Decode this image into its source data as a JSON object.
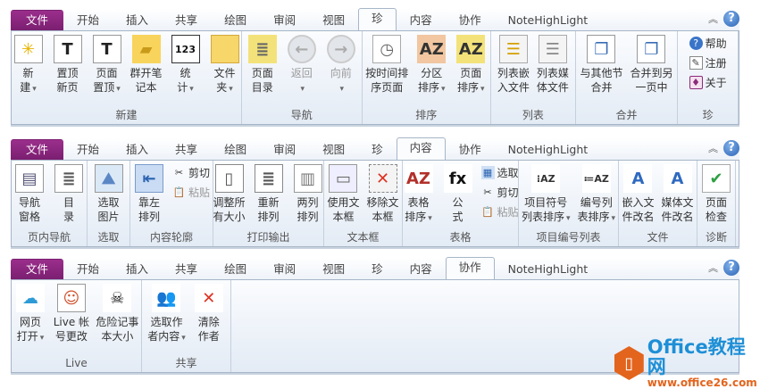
{
  "ribbons": [
    {
      "tabs": [
        "文件",
        "开始",
        "插入",
        "共享",
        "绘图",
        "审阅",
        "视图",
        "珍",
        "内容",
        "协作",
        "NoteHighLight"
      ],
      "active": 7,
      "groups": [
        {
          "label": "新建",
          "items": [
            {
              "type": "large",
              "l1": "新",
              "l2": "建",
              "dd": true,
              "icon": "new-page"
            },
            {
              "type": "large",
              "l1": "置顶",
              "l2": "新页",
              "icon": "new-top-page"
            },
            {
              "type": "large",
              "l1": "页面",
              "l2": "置顶",
              "dd": true,
              "icon": "page-top"
            },
            {
              "type": "large",
              "l1": "群开笔",
              "l2": "记本",
              "icon": "open-folder"
            },
            {
              "type": "large",
              "l1": "统",
              "l2": "计",
              "dd": true,
              "icon": "abc-123"
            },
            {
              "type": "large",
              "l1": "文件",
              "l2": "夹",
              "dd": true,
              "icon": "folder"
            }
          ]
        },
        {
          "label": "导航",
          "items": [
            {
              "type": "large",
              "l1": "页面",
              "l2": "目录",
              "icon": "page-toc"
            },
            {
              "type": "large",
              "l1": "返回",
              "l2": "",
              "dd": true,
              "icon": "back-arrow",
              "disabled": true
            },
            {
              "type": "large",
              "l1": "向前",
              "l2": "",
              "dd": true,
              "icon": "forward-arrow",
              "disabled": true
            }
          ]
        },
        {
          "label": "排序",
          "items": [
            {
              "type": "large",
              "l1": "按时间排",
              "l2": "序页面",
              "icon": "clock-sort"
            },
            {
              "type": "large",
              "l1": "分区",
              "l2": "排序",
              "dd": true,
              "icon": "section-sort"
            },
            {
              "type": "large",
              "l1": "页面",
              "l2": "排序",
              "dd": true,
              "icon": "page-sort"
            }
          ]
        },
        {
          "label": "列表",
          "items": [
            {
              "type": "large",
              "l1": "列表嵌",
              "l2": "入文件",
              "icon": "list-embed"
            },
            {
              "type": "large",
              "l1": "列表媒",
              "l2": "体文件",
              "icon": "list-media"
            }
          ]
        },
        {
          "label": "合并",
          "items": [
            {
              "type": "large",
              "l1": "与其他节",
              "l2": "合并",
              "icon": "merge-section"
            },
            {
              "type": "large",
              "l1": "合并到另",
              "l2": "一页中",
              "icon": "merge-page"
            }
          ]
        },
        {
          "label": "珍",
          "items": [
            {
              "type": "stack",
              "items": [
                {
                  "label": "帮助",
                  "icon": "help"
                },
                {
                  "label": "注册",
                  "icon": "register"
                },
                {
                  "label": "关于",
                  "icon": "about"
                }
              ]
            }
          ]
        }
      ]
    },
    {
      "tabs": [
        "文件",
        "开始",
        "插入",
        "共享",
        "绘图",
        "审阅",
        "视图",
        "珍",
        "内容",
        "协作",
        "NoteHighLight"
      ],
      "active": 8,
      "groups": [
        {
          "label": "页内导航",
          "items": [
            {
              "type": "large",
              "l1": "导航",
              "l2": "窗格",
              "icon": "nav-pane"
            },
            {
              "type": "large",
              "l1": "目",
              "l2": "录",
              "icon": "toc"
            }
          ]
        },
        {
          "label": "选取",
          "items": [
            {
              "type": "large",
              "l1": "选取",
              "l2": "图片",
              "icon": "select-picture"
            }
          ]
        },
        {
          "label": "内容轮廓",
          "items": [
            {
              "type": "large",
              "l1": "靠左",
              "l2": "排列",
              "icon": "align-left"
            },
            {
              "type": "stack",
              "items": [
                {
                  "label": "剪切",
                  "icon": "cut"
                },
                {
                  "label": "粘贴",
                  "icon": "paste",
                  "disabled": true
                }
              ]
            }
          ]
        },
        {
          "label": "打印输出",
          "items": [
            {
              "type": "large",
              "l1": "调整所",
              "l2": "有大小",
              "icon": "resize"
            },
            {
              "type": "large",
              "l1": "重新",
              "l2": "排列",
              "icon": "rearrange"
            },
            {
              "type": "large",
              "l1": "两列",
              "l2": "排列",
              "icon": "two-columns"
            }
          ]
        },
        {
          "label": "文本框",
          "items": [
            {
              "type": "large",
              "l1": "使用文",
              "l2": "本框",
              "icon": "textbox"
            },
            {
              "type": "large",
              "l1": "移除文",
              "l2": "本框",
              "icon": "remove-textbox"
            }
          ]
        },
        {
          "label": "表格",
          "items": [
            {
              "type": "large",
              "l1": "表格",
              "l2": "排序",
              "dd": true,
              "icon": "table-sort"
            },
            {
              "type": "large",
              "l1": "公",
              "l2": "式",
              "icon": "formula"
            },
            {
              "type": "stack",
              "items": [
                {
                  "label": "选取",
                  "icon": "select-table"
                },
                {
                  "label": "剪切",
                  "icon": "cut"
                },
                {
                  "label": "粘贴",
                  "icon": "paste",
                  "disabled": true
                }
              ]
            }
          ]
        },
        {
          "label": "项目编号列表",
          "items": [
            {
              "type": "large",
              "l1": "项目符号",
              "l2": "列表排序",
              "dd": true,
              "icon": "bullet-sort"
            },
            {
              "type": "large",
              "l1": "编号列",
              "l2": "表排序",
              "dd": true,
              "icon": "number-sort"
            }
          ]
        },
        {
          "label": "文件",
          "items": [
            {
              "type": "large",
              "l1": "嵌入文",
              "l2": "件改名",
              "icon": "rename-embed"
            },
            {
              "type": "large",
              "l1": "媒体文",
              "l2": "件改名",
              "icon": "rename-media"
            }
          ]
        },
        {
          "label": "诊断",
          "items": [
            {
              "type": "large",
              "l1": "页面",
              "l2": "检查",
              "icon": "page-check"
            }
          ]
        }
      ]
    },
    {
      "tabs": [
        "文件",
        "开始",
        "插入",
        "共享",
        "绘图",
        "审阅",
        "视图",
        "珍",
        "内容",
        "协作",
        "NoteHighLight"
      ],
      "active": 9,
      "groups": [
        {
          "label": "Live",
          "items": [
            {
              "type": "large",
              "l1": "网页",
              "l2": "打开",
              "dd": true,
              "icon": "cloud"
            },
            {
              "type": "large",
              "l1": "Live 帐",
              "l2": "号更改",
              "icon": "account-card"
            },
            {
              "type": "large",
              "l1": "危险记事",
              "l2": "本大小",
              "icon": "skull"
            }
          ]
        },
        {
          "label": "共享",
          "items": [
            {
              "type": "large",
              "l1": "选取作",
              "l2": "者内容",
              "dd": true,
              "icon": "author-select"
            },
            {
              "type": "large",
              "l1": "清除",
              "l2": "作者",
              "icon": "author-clear"
            }
          ]
        }
      ]
    }
  ],
  "tabctl": {
    "collapse": "︽",
    "help": "?"
  },
  "watermark": {
    "title": "Office教程网",
    "url": "www.office26.com"
  }
}
